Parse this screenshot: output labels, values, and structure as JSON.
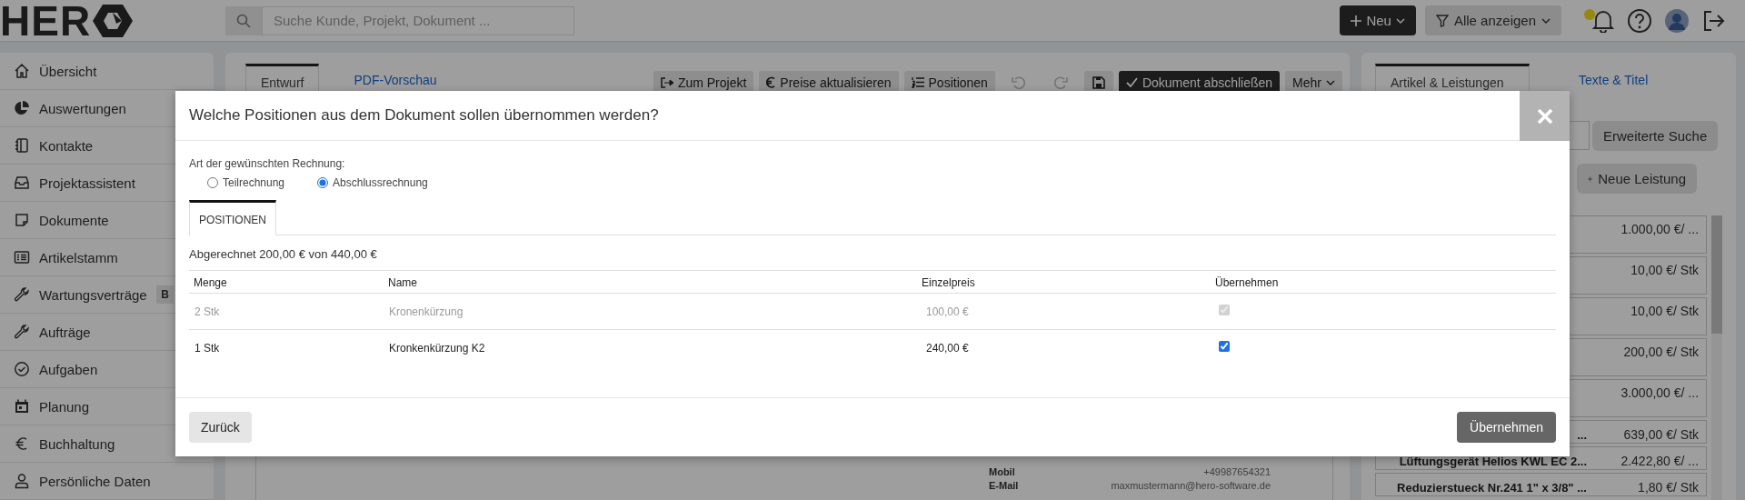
{
  "topbar": {
    "logo": "HER",
    "search": {
      "placeholder": "Suche Kunde, Projekt, Dokument ..."
    },
    "new_button": "Neu",
    "filter_button": "Alle anzeigen",
    "has_notification": true
  },
  "sidebar": {
    "items": [
      {
        "label": "Übersicht"
      },
      {
        "label": "Auswertungen"
      },
      {
        "label": "Kontakte"
      },
      {
        "label": "Projektassistent"
      },
      {
        "label": "Dokumente"
      },
      {
        "label": "Artikelstamm"
      },
      {
        "label": "Wartungsverträge",
        "badge": "B"
      },
      {
        "label": "Aufträge"
      },
      {
        "label": "Aufgaben"
      },
      {
        "label": "Planung"
      },
      {
        "label": "Buchhaltung"
      },
      {
        "label": "Persönliche Daten"
      }
    ]
  },
  "editor": {
    "tabs": [
      {
        "label": "Entwurf",
        "selected": true
      },
      {
        "label": "PDF-Vorschau",
        "selected": false
      }
    ],
    "toolbar": [
      {
        "kind": "text",
        "label": "Zum Projekt"
      },
      {
        "kind": "text",
        "label": "Preise aktualisieren"
      },
      {
        "kind": "text",
        "label": "Positionen"
      },
      {
        "kind": "undo",
        "disabled": true
      },
      {
        "kind": "redo",
        "disabled": true
      },
      {
        "kind": "save",
        "disabled": false
      },
      {
        "kind": "primary",
        "label": "Dokument abschließen"
      },
      {
        "kind": "menu",
        "label": "Mehr"
      }
    ],
    "contact": [
      {
        "label": "Mobil",
        "value": "+49987654321"
      },
      {
        "label": "E-Mail",
        "value": "maxmustermann@hero-software.de"
      }
    ]
  },
  "catalog": {
    "tabs": [
      {
        "label": "Artikel & Leistungen",
        "selected": true
      },
      {
        "label": "Texte & Titel",
        "selected": false
      }
    ],
    "search_button": "Erweiterte Suche",
    "new_button": "Neue Leistung",
    "items": [
      {
        "price": "1.000,00 €/ ..."
      },
      {
        "price": "10,00 €/ Stk"
      },
      {
        "price": "10,00 €/ Stk"
      },
      {
        "price": "200,00 €/ Stk"
      },
      {
        "price": "3.000,00 €/ ..."
      },
      {
        "name": "...",
        "price": "639,00 €/ Stk"
      },
      {
        "name": "Lüftungsgerät Helios KWL EC 2...",
        "price": "2.422,80 €/ ..."
      },
      {
        "name": "Reduzierstueck Nr.241 1\" x 3/8\" ...",
        "price": "1,80 €/ Stk"
      }
    ]
  },
  "dialog": {
    "title": "Welche Positionen aus dem Dokument sollen übernommen werden?",
    "invoice_type": {
      "label": "Art der gewünschten Rechnung:",
      "options": [
        {
          "label": "Teilrechnung",
          "selected": false
        },
        {
          "label": "Abschlussrechnung",
          "selected": true
        }
      ]
    },
    "tabs": [
      {
        "label": "POSITIONEN",
        "selected": true
      }
    ],
    "summary": "Abgerechnet 200,00 € von 440,00 €",
    "table": {
      "columns": [
        "Menge",
        "Name",
        "Einzelpreis",
        "Übernehmen"
      ],
      "rows": [
        {
          "quantity": "2 Stk",
          "name": "Kronenkürzung",
          "unit_price": "100,00 €",
          "checked": true,
          "disabled": true
        },
        {
          "quantity": "1 Stk",
          "name": "Kronkenkürzung K2",
          "unit_price": "240,00 €",
          "checked": true,
          "disabled": false
        }
      ]
    },
    "back_button": "Zurück",
    "confirm_button": "Übernehmen"
  }
}
